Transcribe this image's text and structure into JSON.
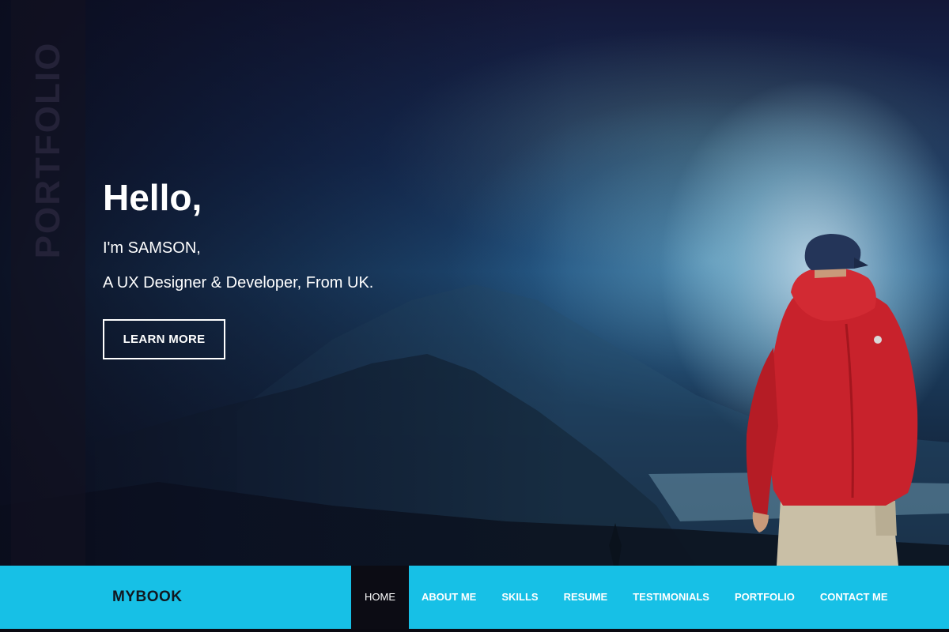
{
  "hero": {
    "side_label": "PORTFOLIO",
    "heading": "Hello,",
    "intro": "I'm SAMSON,",
    "role": "A UX Designer & Developer, From UK.",
    "cta_label": "LEARN MORE"
  },
  "nav": {
    "brand": "MYBOOK",
    "items": [
      {
        "label": "HOME",
        "active": true
      },
      {
        "label": "ABOUT ME"
      },
      {
        "label": "SKILLS"
      },
      {
        "label": "RESUME"
      },
      {
        "label": "TESTIMONIALS"
      },
      {
        "label": "PORTFOLIO"
      },
      {
        "label": "CONTACT ME"
      }
    ]
  },
  "colors": {
    "nav_background": "#17c0e6",
    "nav_active_background": "#0c0c14",
    "text_light": "#ffffff",
    "brand_text": "#111820",
    "jacket_red": "#c8222c"
  }
}
